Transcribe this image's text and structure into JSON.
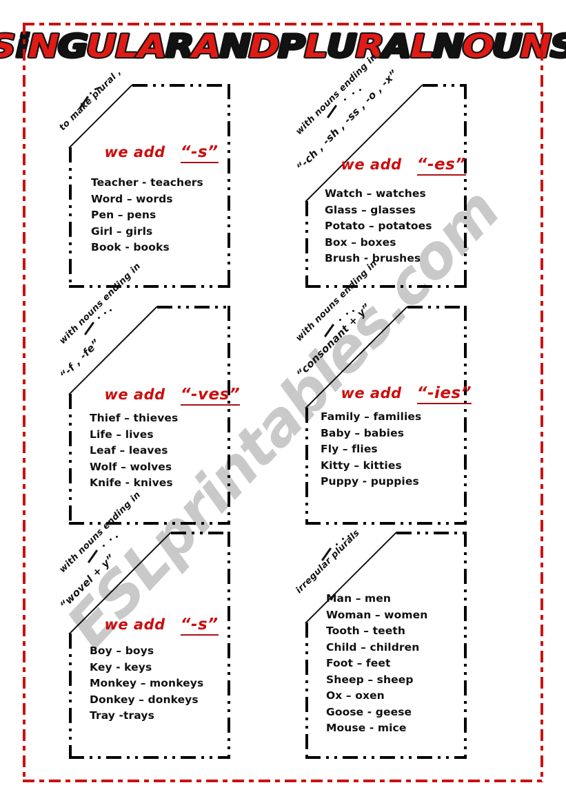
{
  "worksheet": {
    "title": "SINGULAR AND PLURAL NOUNS",
    "title_letters": [
      {
        "ch": "S",
        "color": "red"
      },
      {
        "ch": "i",
        "color": "black"
      },
      {
        "ch": "N",
        "color": "red"
      },
      {
        "ch": "G",
        "color": "black"
      },
      {
        "ch": "U",
        "color": "red"
      },
      {
        "ch": "L",
        "color": "red"
      },
      {
        "ch": "A",
        "color": "red"
      },
      {
        "ch": "R",
        "color": "black"
      },
      {
        "ch": " ",
        "color": "space"
      },
      {
        "ch": "A",
        "color": "red"
      },
      {
        "ch": "N",
        "color": "black"
      },
      {
        "ch": "D",
        "color": "red"
      },
      {
        "ch": " ",
        "color": "space"
      },
      {
        "ch": "P",
        "color": "black"
      },
      {
        "ch": "L",
        "color": "red"
      },
      {
        "ch": "U",
        "color": "black"
      },
      {
        "ch": "R",
        "color": "red"
      },
      {
        "ch": "A",
        "color": "black"
      },
      {
        "ch": "L",
        "color": "red"
      },
      {
        "ch": " ",
        "color": "space"
      },
      {
        "ch": "N",
        "color": "black"
      },
      {
        "ch": "O",
        "color": "red"
      },
      {
        "ch": "U",
        "color": "black"
      },
      {
        "ch": "N",
        "color": "red"
      },
      {
        "ch": "S",
        "color": "black"
      }
    ],
    "watermark": "ESLprintables.com",
    "colors": {
      "title_red": "#e01b16",
      "title_black": "#121212",
      "rule_red": "#cc0d0d",
      "frame_red": "#cc1111",
      "watermark_gray": "#c9c9c9"
    }
  },
  "boxes": [
    {
      "id": "box-add-s",
      "banner_line1": "to make plural ,",
      "banner_line2": "",
      "rule_label": "we add",
      "rule_suffix": "“-s”",
      "examples": [
        "Teacher  -  teachers",
        "Word – words",
        "Pen – pens",
        "Girl – girls",
        "Book  -  books"
      ]
    },
    {
      "id": "box-add-es",
      "banner_line1": "with nouns ending in",
      "banner_line2": "“-ch , -sh , -ss , -o , -x”",
      "rule_label": "we add",
      "rule_suffix": "“-es”",
      "examples": [
        "Watch – watches",
        "Glass – glasses",
        "Potato – potatoes",
        "Box – boxes",
        "Brush  -  brushes"
      ]
    },
    {
      "id": "box-add-ves",
      "banner_line1": "with nouns ending in",
      "banner_line2": "“-f , -fe”",
      "rule_label": "we add",
      "rule_suffix": "“-ves”",
      "examples": [
        "Thief – thieves",
        "Life – lives",
        "Leaf – leaves",
        "Wolf – wolves",
        "Knife  -  knives"
      ]
    },
    {
      "id": "box-add-ies",
      "banner_line1": "with nouns ending in",
      "banner_line2": "“consonant + y”",
      "rule_label": "we add",
      "rule_suffix": "“-ies”",
      "examples": [
        "Family – families",
        "Baby – babies",
        "Fly – flies",
        "Kitty – kitties",
        "Puppy  -  puppies"
      ]
    },
    {
      "id": "box-vowel-y-s",
      "banner_line1": "with nouns ending in",
      "banner_line2": "“wovel + y”",
      "rule_label": "we add",
      "rule_suffix": "“-s”",
      "examples": [
        "Boy –  boys",
        "Key  -  keys",
        "Monkey – monkeys",
        "Donkey – donkeys",
        "Tray  -trays"
      ]
    },
    {
      "id": "box-irregular",
      "banner_line1": "irregular  plurals",
      "banner_line2": "",
      "rule_label": "",
      "rule_suffix": "",
      "examples": [
        "Man – men",
        "Woman – women",
        "Tooth – teeth",
        "Child – children",
        "Foot – feet",
        "Sheep – sheep",
        "Ox – oxen",
        "Goose  -  geese",
        "Mouse  -  mice"
      ]
    }
  ]
}
